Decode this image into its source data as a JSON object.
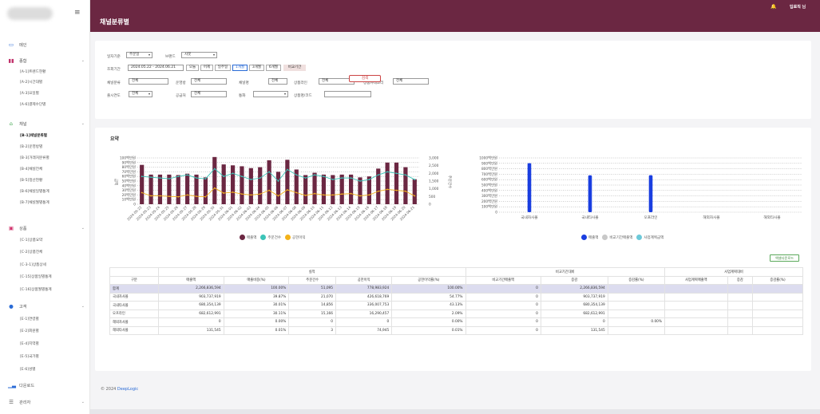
{
  "header": {
    "title": "채널분류별",
    "user": "딥로직 님"
  },
  "sidebar": {
    "items": [
      {
        "icon": "monitor-icon",
        "label": "메인",
        "children": []
      },
      {
        "icon": "bar-chart-icon",
        "label": "종합",
        "children": [
          "[A-1]트렌드현황",
          "[A-2]시간대별",
          "[A-3]요일별",
          "[A-6]결제수단별"
        ]
      },
      {
        "icon": "shop-icon",
        "label": "채널",
        "children": [
          "[B-1]채널분류별",
          "[B-2]운영방별",
          "[B-3]거래처분류별",
          "[B-4]채널전체",
          "[B-5]정산현황",
          "[B-6]채널일별통계",
          "[B-7]채널월별통계"
        ]
      },
      {
        "icon": "box-icon",
        "label": "상품",
        "children": [
          "[C-1]상품요약",
          "[C-2]상품전체",
          "[C-3-1]상품상세",
          "[C-15]상품일별통계",
          "[C-16]상품월별통계"
        ]
      },
      {
        "icon": "user-icon",
        "label": "고객",
        "children": [
          "[E-1]연령별",
          "[E-2]회원별",
          "[E-4]지역별",
          "[E-5]국가별",
          "[E-6]성별"
        ]
      },
      {
        "icon": "download-icon",
        "label": "다운로드",
        "children": []
      },
      {
        "icon": "list-icon",
        "label": "관리자",
        "children": []
      }
    ]
  },
  "filters": {
    "date_basis_label": "일자기준",
    "date_basis_value": "주문일",
    "brand_label": "브랜드",
    "brand_value": "사봇",
    "period_label": "조회기간",
    "period_value": "2024.05.22 - 2024.06.21",
    "period_buttons": [
      "오늘",
      "어제",
      "일주일",
      "1개월",
      "3개월",
      "6개월",
      "비교기간"
    ],
    "channel_class_label": "채널분류",
    "channel_class_value": "전체",
    "operator_label": "운영방",
    "operator_value": "전체",
    "channel_name_label": "채널명",
    "channel_name_value": "전체",
    "product_line_label": "상품라인",
    "product_line_value": "전체",
    "product_category_label": "상품카테고리",
    "product_category_value": "전체",
    "release_year_label": "출시연도",
    "release_year_value": "전체",
    "supplier_label": "공급처",
    "supplier_value": "전체",
    "currency_label": "통화",
    "currency_value": "",
    "product_name_label": "상품명/코드",
    "product_name_value": "",
    "search_label": "검색"
  },
  "summary": {
    "title": "요약"
  },
  "chart_data": [
    {
      "type": "bar",
      "y_tick_labels": [
        "0",
        "10백만원",
        "20백만원",
        "30백만원",
        "40백만원",
        "50백만원",
        "60백만원",
        "70백만원",
        "80백만원",
        "90백만원",
        "100백만원"
      ],
      "y2_tick_labels": [
        "0",
        "500",
        "1,000",
        "1,500",
        "2,000",
        "2,500",
        "3,000"
      ],
      "ylim": [
        0,
        100
      ],
      "y2lim": [
        0,
        3000
      ],
      "categories": [
        "2024-05-22",
        "2024-05-23",
        "2024-05-24",
        "2024-05-25",
        "2024-05-26",
        "2024-05-27",
        "2024-05-28",
        "2024-05-29",
        "2024-05-30",
        "2024-05-31",
        "2024-06-01",
        "2024-06-02",
        "2024-06-03",
        "2024-06-04",
        "2024-06-05",
        "2024-06-06",
        "2024-06-07",
        "2024-06-08",
        "2024-06-09",
        "2024-06-10",
        "2024-06-11",
        "2024-06-12",
        "2024-06-13",
        "2024-06-14",
        "2024-06-15",
        "2024-06-16",
        "2024-06-17",
        "2024-06-18",
        "2024-06-19",
        "2024-06-20",
        "2024-06-21"
      ],
      "series": [
        {
          "name": "매출액",
          "kind": "bar",
          "axis": "left",
          "color": "#6b2742",
          "values": [
            85,
            64,
            64,
            64,
            63,
            66,
            64,
            58,
            102,
            86,
            84,
            82,
            78,
            80,
            95,
            70,
            96,
            75,
            63,
            68,
            64,
            63,
            64,
            64,
            58,
            60,
            77,
            90,
            90,
            80,
            54
          ]
        },
        {
          "name": "주문건수",
          "kind": "line",
          "axis": "right",
          "color": "#3cc4b8",
          "values": [
            1800,
            1750,
            1700,
            1650,
            1800,
            1900,
            1700,
            1650,
            2300,
            1800,
            2000,
            1800,
            1600,
            1700,
            2100,
            1500,
            2250,
            1900,
            1700,
            1900,
            1800,
            1600,
            1700,
            1700,
            1500,
            1600,
            1900,
            2100,
            2000,
            1900,
            1600
          ]
        },
        {
          "name": "공헌이익",
          "kind": "line",
          "axis": "left",
          "color": "#f3b21a",
          "values": [
            25,
            18,
            18,
            17,
            16,
            20,
            17,
            16,
            35,
            24,
            26,
            22,
            20,
            22,
            30,
            18,
            31,
            25,
            19,
            23,
            20,
            20,
            22,
            23,
            18,
            20,
            28,
            32,
            30,
            28,
            18
          ]
        }
      ]
    },
    {
      "type": "bar",
      "y_tick_labels": [
        "0",
        "100백만원",
        "200백만원",
        "300백만원",
        "400백만원",
        "500백만원",
        "600백만원",
        "700백만원",
        "800백만원",
        "900백만원",
        "1000백만원"
      ],
      "ylim": [
        0,
        1000
      ],
      "categories": [
        "국내자사몰",
        "국내타사몰",
        "오프라인",
        "해외자사몰",
        "해외타사몰"
      ],
      "series": [
        {
          "name": "매출액",
          "color": "#1a3ee0",
          "values": [
            903.7,
            680.4,
            682.6,
            0,
            0.13
          ]
        },
        {
          "name": "비교기간매출액",
          "color": "#c8c8c8",
          "values": [
            0,
            0,
            0,
            0,
            0
          ]
        },
        {
          "name": "사업계획금액",
          "color": "#6cc9d9",
          "values": [
            0,
            0,
            0,
            0,
            0
          ]
        }
      ]
    }
  ],
  "table": {
    "excel_label": "엑셀다운로드",
    "group_headers": [
      "실적",
      "비교기간대비",
      "사업계획대비"
    ],
    "columns": [
      "구분",
      "매출액",
      "매출비중(%)",
      "주문건수",
      "공헌이익",
      "공헌이익률(%)",
      "비교기간매출액",
      "증감",
      "증감률(%)",
      "사업계획매출액",
      "증감",
      "증감률(%)"
    ],
    "rows": [
      [
        "합계",
        "2,266,836,594",
        "100.00%",
        "51,095",
        "778,983,924",
        "100.00%",
        "0",
        "2,266,836,594",
        "",
        "",
        "",
        ""
      ],
      [
        "국내자사몰",
        "903,737,919",
        "39.87%",
        "21,070",
        "426,618,769",
        "54.77%",
        "0",
        "903,737,919",
        "",
        "",
        "",
        ""
      ],
      [
        "국내타사몰",
        "680,354,139",
        "30.01%",
        "14,856",
        "336,007,753",
        "43.13%",
        "0",
        "680,354,139",
        "",
        "",
        "",
        ""
      ],
      [
        "오프라인",
        "682,612,991",
        "30.11%",
        "15,166",
        "16,290,457",
        "2.09%",
        "0",
        "682,612,991",
        "",
        "",
        "",
        ""
      ],
      [
        "해외자사몰",
        "0",
        "0.00%",
        "0",
        "0",
        "0.00%",
        "0",
        "0",
        "0.00%",
        "",
        "",
        ""
      ],
      [
        "해외타사몰",
        "131,545",
        "0.01%",
        "3",
        "74,945",
        "0.01%",
        "0",
        "131,545",
        "",
        "",
        "",
        ""
      ]
    ]
  },
  "footer": {
    "copyright": "© 2024",
    "brand": "DeepLogic"
  }
}
